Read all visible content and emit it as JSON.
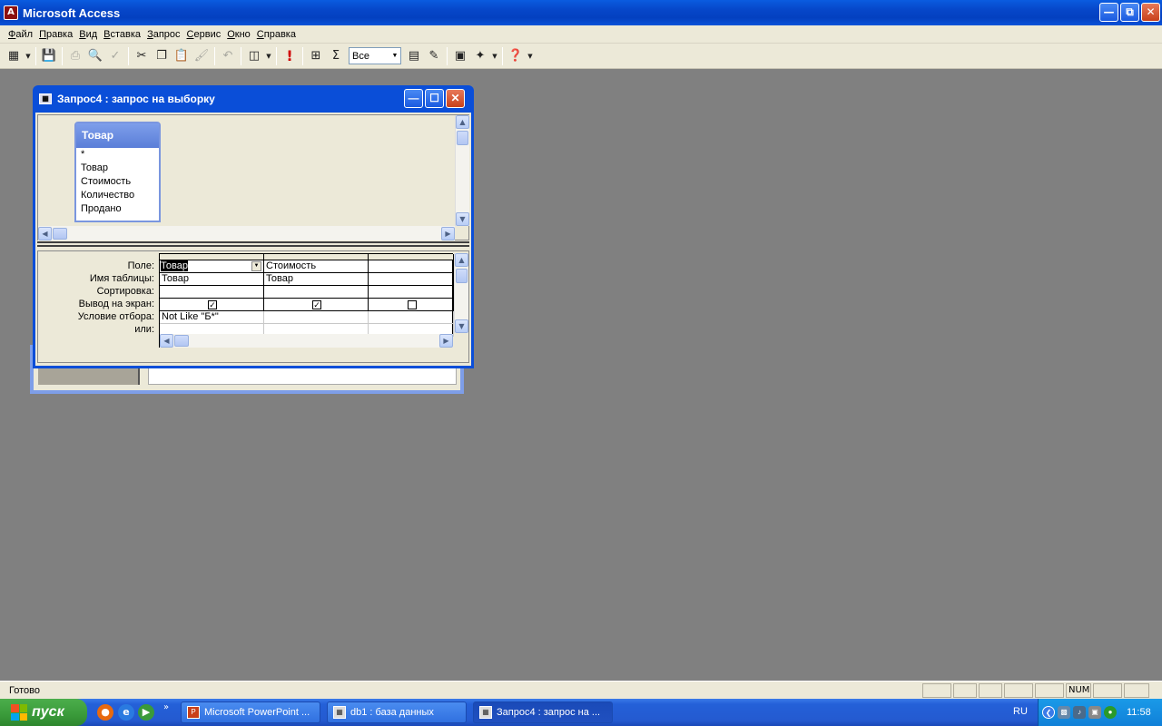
{
  "app": {
    "title": "Microsoft Access",
    "icon": "access-key-icon"
  },
  "menu": [
    "Файл",
    "Правка",
    "Вид",
    "Вставка",
    "Запрос",
    "Сервис",
    "Окно",
    "Справка"
  ],
  "toolbar": {
    "top_values_combo": "Все"
  },
  "query_window": {
    "title": "Запрос4 : запрос на выборку",
    "table": {
      "name": "Товар",
      "fields": [
        "*",
        "Товар",
        "Стоимость",
        "Количество",
        "Продано"
      ]
    },
    "row_labels": [
      "Поле:",
      "Имя таблицы:",
      "Сортировка:",
      "Вывод на экран:",
      "Условие отбора:",
      "или:"
    ],
    "columns": [
      {
        "field": "Товар",
        "table": "Товар",
        "sort": "",
        "show": true,
        "criteria": "Not Like \"Б*\"",
        "or": ""
      },
      {
        "field": "Стоимость",
        "table": "Товар",
        "sort": "",
        "show": true,
        "criteria": "",
        "or": ""
      },
      {
        "field": "",
        "table": "",
        "sort": "",
        "show": false,
        "criteria": "",
        "or": ""
      }
    ]
  },
  "status": {
    "text": "Готово",
    "num": "NUM"
  },
  "taskbar": {
    "start_label": "пуск",
    "tasks": [
      "Microsoft PowerPoint ...",
      "db1 : база данных",
      "Запрос4 : запрос на ..."
    ],
    "lang": "RU",
    "clock": "11:58"
  }
}
